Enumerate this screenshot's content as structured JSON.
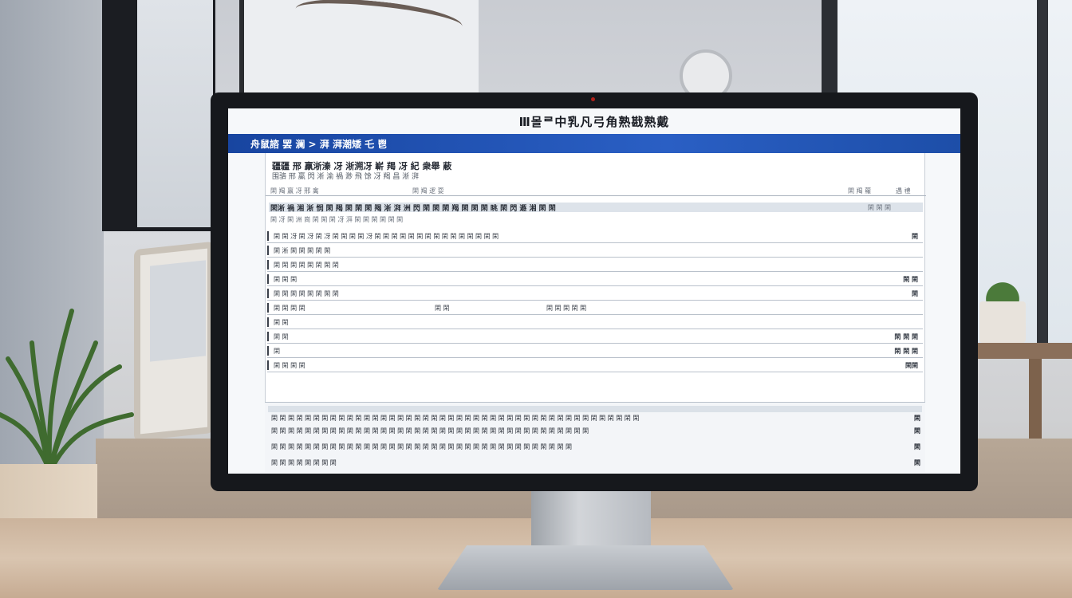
{
  "app": {
    "title": "Ⅲ몰ᄅ中乳凡弓角熟戡熟戴",
    "nav_breadcrumb": "舟鼠諮 罢 澜  >  湃 湃潮矮 乇 鬯"
  },
  "panel": {
    "heading": "疆疆 邢 羸淅溱 冴 淅溯冴 嶄 羯 冴 紀 衆舉 蔽",
    "subheading": "围骆 邢 羸 閃 淅 渝 禍 渺 飛 馀 冴 羯 昌 淅 湃",
    "tabs": [
      "閑 羯 羸 冴 邢 禽",
      "閑 羯 逻 耍",
      "閑 羯 蘿",
      "遇 禮"
    ],
    "section_header": "閑淅 禍 湘 淅 悯 閑 羯 閑 閑 閑 羯 淅 湃 洲 閃 閑 閑 閑 羯 閑 閑 閑 眺 閑 閃 遯 湘 閑 閑",
    "section_header_right": "閑 閑 閑",
    "caption": "閑 冴 閑 洲 崗 閑 閑 閑 冴 湃 閑 閑 閑 閑 閑 閑",
    "rows": [
      {
        "left": "閑 閑 冴 閑 冴 閑 冴 閑 閑 閑 閑 冴 閑 閑 閑 閑 閑 閑 閑 閑 閑 閑 閑 閑 閑 閑 閑",
        "right": "閑"
      },
      {
        "left": "閑 淅 閑 閑 閑 閑 閑",
        "right": ""
      },
      {
        "left": "閑 閑 閑 閑 閑 閑 閑 閑",
        "right": ""
      },
      {
        "left": "閑 閑 閑",
        "right": "閑 閑"
      },
      {
        "left": "閑 閑 閑 閑 閑 閑 閑 閑",
        "right": "閑"
      },
      {
        "left": "閑 閑 閑 閑",
        "mid": "閑 閑",
        "mid2": "閑 閑 閑 閑 閑",
        "right": ""
      },
      {
        "left": "閑 閑",
        "right": ""
      },
      {
        "left": "閑 閑",
        "right": "閑 閑 閑"
      },
      {
        "left": "閑",
        "right": "閑 閑 閑"
      },
      {
        "left": "閑 閑 閑 閑",
        "right": "閑閑"
      }
    ]
  },
  "summary": {
    "lines": [
      "閑 閑 閑 閑 閑 閑 閑 閑 閑 閑 閑 閑 閑 閑 閑 閑 閑 閑 閑 閑 閑 閑 閑 閑 閑 閑 閑 閑 閑 閑 閑 閑 閑 閑 閑 閑 閑 閑 閑 閑 閑 閑 閑 閑",
      "閑 閑 閑 閑 閑 閑 閑 閑 閑 閑 閑 閑 閑 閑 閑 閑 閑 閑 閑 閑 閑 閑 閑 閑 閑 閑 閑 閑 閑 閑 閑 閑 閑 閑 閑 閑 閑 閑",
      "閑 閑 閑 閑 閑 閑 閑 閑 閑 閑 閑 閑 閑 閑 閑 閑 閑 閑 閑 閑 閑 閑 閑 閑 閑 閑 閑 閑 閑 閑 閑 閑 閑 閑 閑 閑",
      "閑 閑 閑 閑 閑 閑 閑 閑"
    ],
    "right": [
      "閑",
      "閑",
      "閑",
      "閑"
    ]
  },
  "colors": {
    "accent_bar": "#1d4ea8",
    "screen_bg": "#f6f8fa",
    "bezel": "#16181c"
  }
}
